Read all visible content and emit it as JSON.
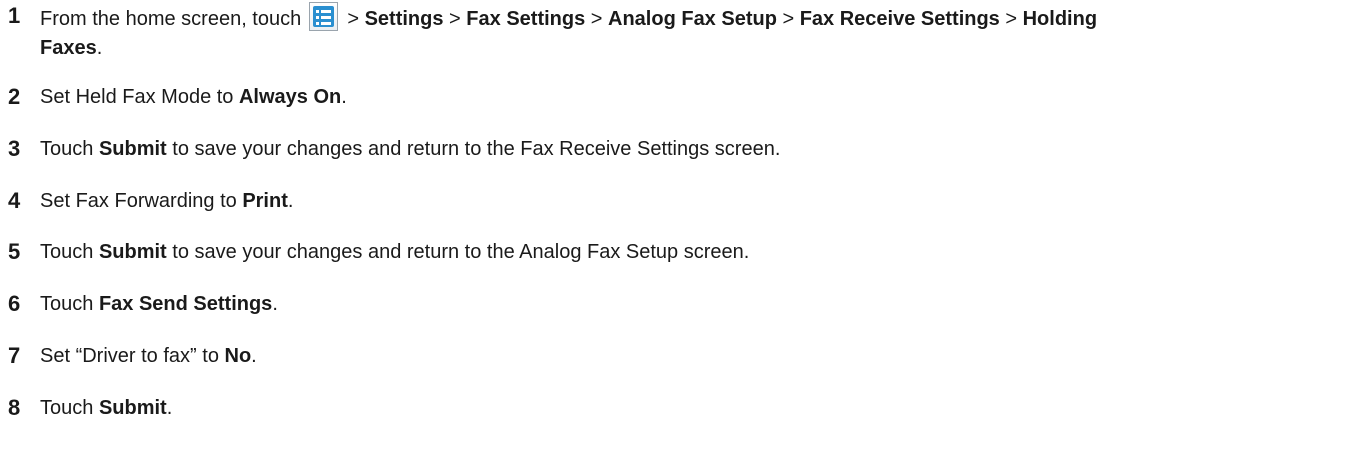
{
  "steps": [
    {
      "number": "1",
      "parts": {
        "a": "From the home screen, touch",
        "b": " > ",
        "c": "Settings",
        "d": " > ",
        "e": "Fax Settings",
        "f": " > ",
        "g": "Analog Fax Setup",
        "h": " > ",
        "i": "Fax Receive Settings",
        "j": " > ",
        "k": "Holding",
        "l": "Faxes",
        "m": "."
      },
      "icon": "menu-list-icon"
    },
    {
      "number": "2",
      "parts": {
        "a": "Set Held Fax Mode to ",
        "b": "Always On",
        "c": "."
      }
    },
    {
      "number": "3",
      "parts": {
        "a": "Touch ",
        "b": "Submit",
        "c": " to save your changes and return to the Fax Receive Settings screen."
      }
    },
    {
      "number": "4",
      "parts": {
        "a": "Set Fax Forwarding to ",
        "b": "Print",
        "c": "."
      }
    },
    {
      "number": "5",
      "parts": {
        "a": "Touch ",
        "b": "Submit",
        "c": " to save your changes and return to the Analog Fax Setup screen."
      }
    },
    {
      "number": "6",
      "parts": {
        "a": "Touch ",
        "b": "Fax Send Settings",
        "c": "."
      }
    },
    {
      "number": "7",
      "parts": {
        "a": "Set “Driver to fax” to ",
        "b": "No",
        "c": "."
      }
    },
    {
      "number": "8",
      "parts": {
        "a": "Touch ",
        "b": "Submit",
        "c": "."
      }
    }
  ]
}
